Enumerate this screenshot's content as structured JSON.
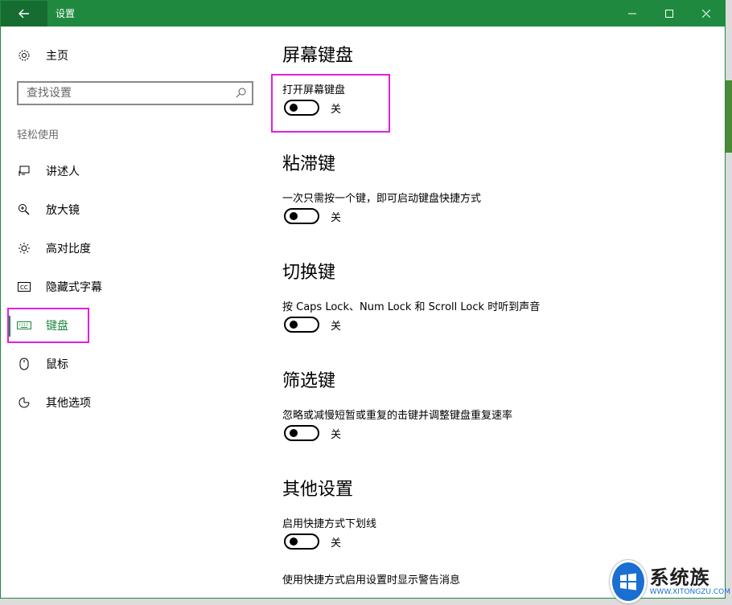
{
  "window": {
    "title": "设置"
  },
  "sidebar": {
    "home_label": "主页",
    "search_placeholder": "查找设置",
    "section_label": "轻松使用",
    "items": [
      {
        "label": "讲述人",
        "icon": "narrator-icon"
      },
      {
        "label": "放大镜",
        "icon": "magnifier-icon"
      },
      {
        "label": "高对比度",
        "icon": "high-contrast-icon"
      },
      {
        "label": "隐藏式字幕",
        "icon": "closed-captions-icon"
      },
      {
        "label": "键盘",
        "icon": "keyboard-icon",
        "active": true
      },
      {
        "label": "鼠标",
        "icon": "mouse-icon"
      },
      {
        "label": "其他选项",
        "icon": "other-options-icon"
      }
    ]
  },
  "content": {
    "groups": [
      {
        "title": "屏幕键盘",
        "desc": "打开屏幕键盘",
        "state": "关",
        "on": false
      },
      {
        "title": "粘滞键",
        "desc": "一次只需按一个键，即可启动键盘快捷方式",
        "state": "关",
        "on": false
      },
      {
        "title": "切换键",
        "desc": "按 Caps Lock、Num Lock 和 Scroll Lock 时听到声音",
        "state": "关",
        "on": false
      },
      {
        "title": "筛选键",
        "desc": "忽略或减慢短暂或重复的击键并调整键盘重复速率",
        "state": "关",
        "on": false
      },
      {
        "title": "其他设置",
        "desc": "启用快捷方式下划线",
        "state": "关",
        "on": false
      }
    ],
    "last_desc": "使用快捷方式启用设置时显示警告消息"
  },
  "watermark": {
    "name": "系统族",
    "url": "WWW.XITONGZU.COM"
  },
  "colors": {
    "accent": "#1f8a3f",
    "highlight": "#e020e0"
  }
}
